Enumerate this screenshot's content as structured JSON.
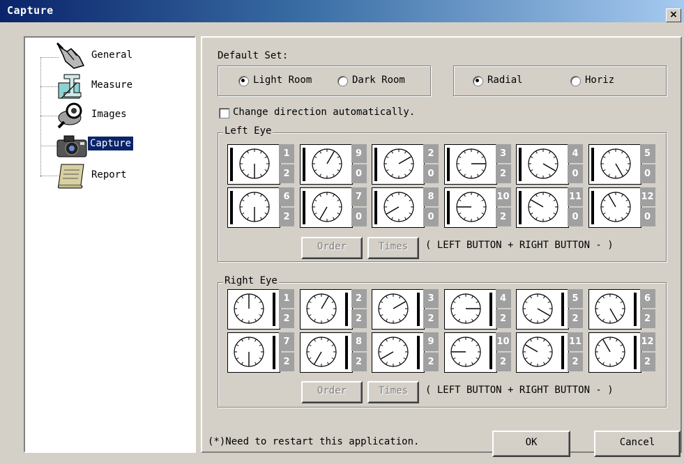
{
  "window": {
    "title": "Capture",
    "close_glyph": "×"
  },
  "sidebar": {
    "items": [
      {
        "label": "General",
        "icon": "hand-pointer-icon"
      },
      {
        "label": "Measure",
        "icon": "measure-tool-icon"
      },
      {
        "label": "Images",
        "icon": "magnifier-images-icon"
      },
      {
        "label": "Capture",
        "icon": "camera-icon",
        "selected": true
      },
      {
        "label": "Report",
        "icon": "scroll-report-icon"
      }
    ]
  },
  "default_set": {
    "label": "Default Set:",
    "room": {
      "options": [
        "Light Room",
        "Dark Room"
      ],
      "selected": "Light Room"
    },
    "direction": {
      "options": [
        "Radial",
        "Horiz"
      ],
      "selected": "Radial"
    }
  },
  "auto_direction": {
    "label": "Change direction automatically.",
    "checked": false
  },
  "left_eye": {
    "title": "Left Eye",
    "cells": [
      {
        "top": "1",
        "bottom": "2",
        "hour": 6
      },
      {
        "top": "9",
        "bottom": "0",
        "hour": 1
      },
      {
        "top": "2",
        "bottom": "0",
        "hour": 2
      },
      {
        "top": "3",
        "bottom": "2",
        "hour": 3
      },
      {
        "top": "4",
        "bottom": "0",
        "hour": 4
      },
      {
        "top": "5",
        "bottom": "0",
        "hour": 5
      },
      {
        "top": "6",
        "bottom": "2",
        "hour": 6
      },
      {
        "top": "7",
        "bottom": "0",
        "hour": 7
      },
      {
        "top": "8",
        "bottom": "0",
        "hour": 8
      },
      {
        "top": "10",
        "bottom": "2",
        "hour": 9
      },
      {
        "top": "11",
        "bottom": "0",
        "hour": 10
      },
      {
        "top": "12",
        "bottom": "0",
        "hour": 11
      }
    ],
    "order_label": "Order",
    "times_label": "Times",
    "hint": "( LEFT BUTTON +   RIGHT BUTTON - )"
  },
  "right_eye": {
    "title": "Right Eye",
    "cells": [
      {
        "top": "1",
        "bottom": "2",
        "hour": 12
      },
      {
        "top": "2",
        "bottom": "2",
        "hour": 1
      },
      {
        "top": "3",
        "bottom": "2",
        "hour": 2
      },
      {
        "top": "4",
        "bottom": "2",
        "hour": 3
      },
      {
        "top": "5",
        "bottom": "2",
        "hour": 4
      },
      {
        "top": "6",
        "bottom": "2",
        "hour": 5
      },
      {
        "top": "7",
        "bottom": "2",
        "hour": 6
      },
      {
        "top": "8",
        "bottom": "2",
        "hour": 7
      },
      {
        "top": "9",
        "bottom": "2",
        "hour": 8
      },
      {
        "top": "10",
        "bottom": "2",
        "hour": 9
      },
      {
        "top": "11",
        "bottom": "2",
        "hour": 10
      },
      {
        "top": "12",
        "bottom": "2",
        "hour": 11
      }
    ],
    "order_label": "Order",
    "times_label": "Times",
    "hint": "( LEFT BUTTON +   RIGHT BUTTON - )"
  },
  "footer": {
    "note": "(*)Need to restart this application.",
    "ok_label": "OK",
    "cancel_label": "Cancel"
  }
}
